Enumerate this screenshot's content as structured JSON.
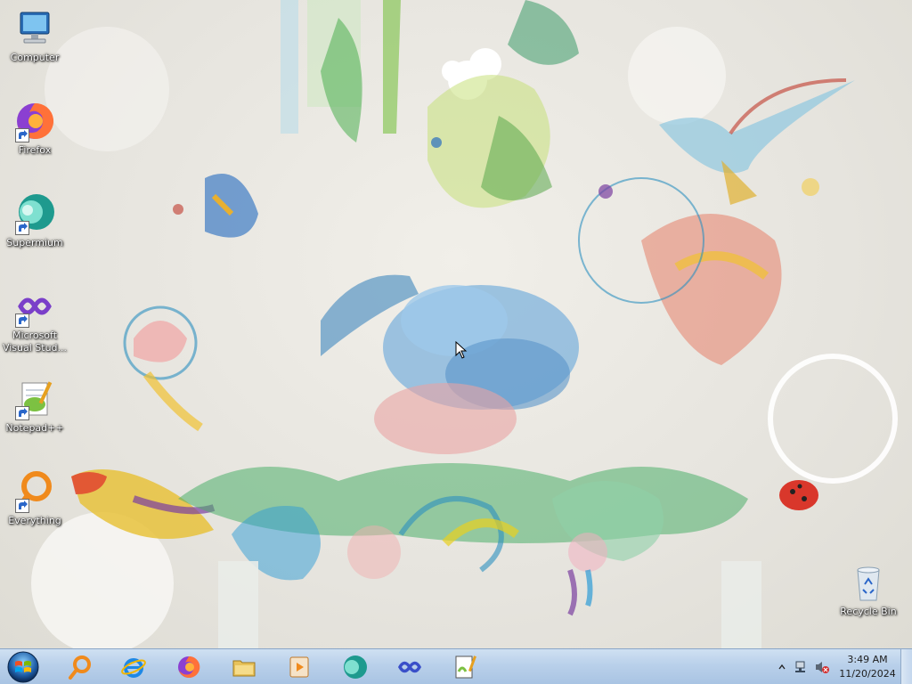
{
  "desktop": {
    "icons": [
      {
        "label": "Computer",
        "icon": "computer-icon"
      },
      {
        "label": "Firefox",
        "icon": "firefox-icon"
      },
      {
        "label": "Supermium",
        "icon": "supermium-icon"
      },
      {
        "label": "Microsoft Visual Stud...",
        "icon": "visual-studio-icon"
      },
      {
        "label": "Notepad++",
        "icon": "notepadpp-icon"
      },
      {
        "label": "Everything",
        "icon": "everything-icon"
      },
      {
        "label": "Recycle Bin",
        "icon": "recycle-bin-icon"
      }
    ]
  },
  "taskbar": {
    "pinned": [
      {
        "icon": "everything-search-icon"
      },
      {
        "icon": "internet-explorer-icon"
      },
      {
        "icon": "firefox-icon"
      },
      {
        "icon": "file-explorer-icon"
      },
      {
        "icon": "media-player-icon"
      },
      {
        "icon": "supermium-icon"
      },
      {
        "icon": "visual-studio-icon"
      },
      {
        "icon": "notepadpp-icon"
      }
    ],
    "tray": {
      "time": "3:49 AM",
      "date": "11/20/2024",
      "icons": [
        "show-hidden-icons-chevron",
        "network-icon",
        "volume-muted-icon"
      ]
    }
  },
  "colors": {
    "taskbar_top": "#cfe0f2",
    "taskbar_bottom": "#a9c4e3",
    "wallpaper_bg": "#e8e6e0"
  }
}
